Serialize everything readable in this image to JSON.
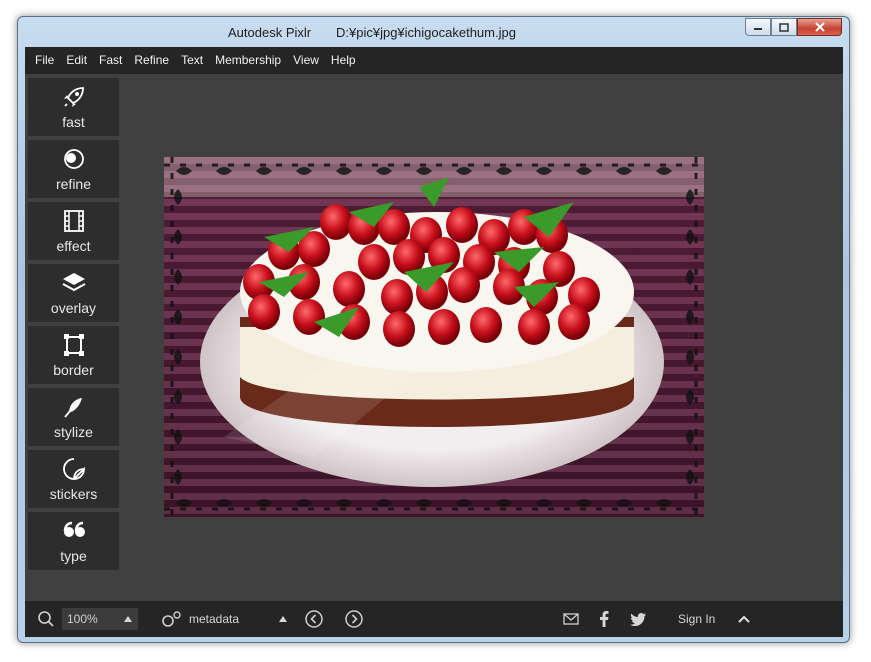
{
  "window": {
    "app_title": "Autodesk Pixlr",
    "file_path": "D:¥pic¥jpg¥ichigocakethum.jpg",
    "controls": [
      "minimize",
      "maximize",
      "close"
    ]
  },
  "menu": {
    "items": [
      "File",
      "Edit",
      "Fast",
      "Refine",
      "Text",
      "Membership",
      "View",
      "Help"
    ]
  },
  "sidebar": {
    "tools": [
      {
        "label": "fast",
        "icon": "rocket-icon"
      },
      {
        "label": "refine",
        "icon": "refine-icon"
      },
      {
        "label": "effect",
        "icon": "film-icon"
      },
      {
        "label": "overlay",
        "icon": "layers-icon"
      },
      {
        "label": "border",
        "icon": "frame-icon"
      },
      {
        "label": "stylize",
        "icon": "feather-icon"
      },
      {
        "label": "stickers",
        "icon": "sticker-icon"
      },
      {
        "label": "type",
        "icon": "quote-icon"
      }
    ]
  },
  "canvas": {
    "image_subject": "raspberry-cream-cake-photo"
  },
  "statusbar": {
    "zoom_value": "100%",
    "metadata_label": "metadata",
    "sign_in_label": "Sign In"
  },
  "colors": {
    "menubar": "#252525",
    "workspace": "#404040",
    "tool_button": "#2d2d2d",
    "close_button": "#c84030"
  }
}
